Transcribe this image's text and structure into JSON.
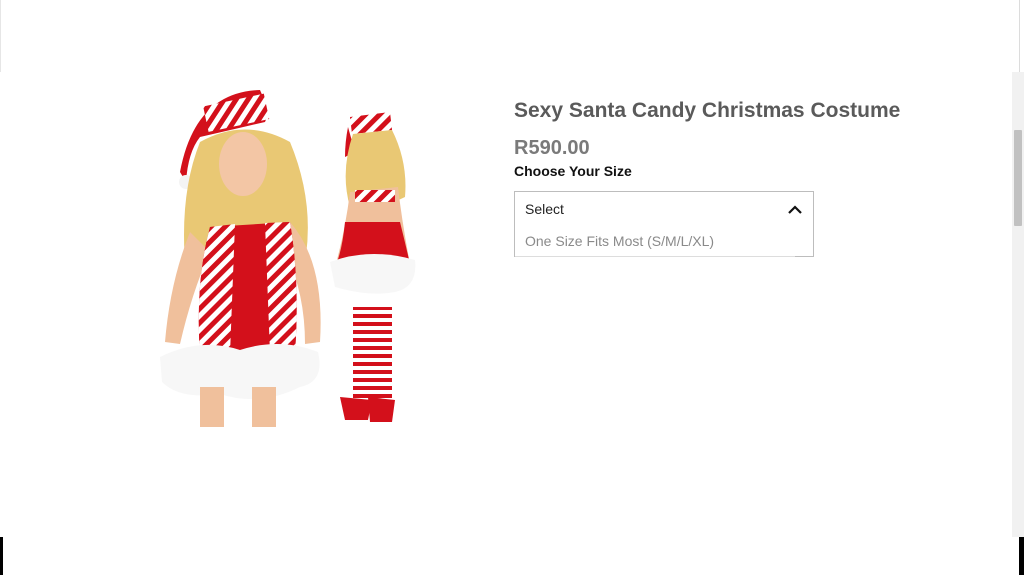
{
  "product": {
    "title": "Sexy Santa Candy Christmas Costume",
    "price": "R590.00",
    "image_alt": "red and white striped Santa costume with hat and stockings"
  },
  "size_selector": {
    "label": "Choose Your Size",
    "selected": "Select",
    "options": [
      "One Size Fits Most (S/M/L/XL)"
    ],
    "expanded": true
  },
  "icons": {
    "dropdown": "chevron-up-icon"
  },
  "colors": {
    "costume_red": "#d3101b",
    "title_gray": "#5a5a5a",
    "price_gray": "#7a7a7a"
  }
}
